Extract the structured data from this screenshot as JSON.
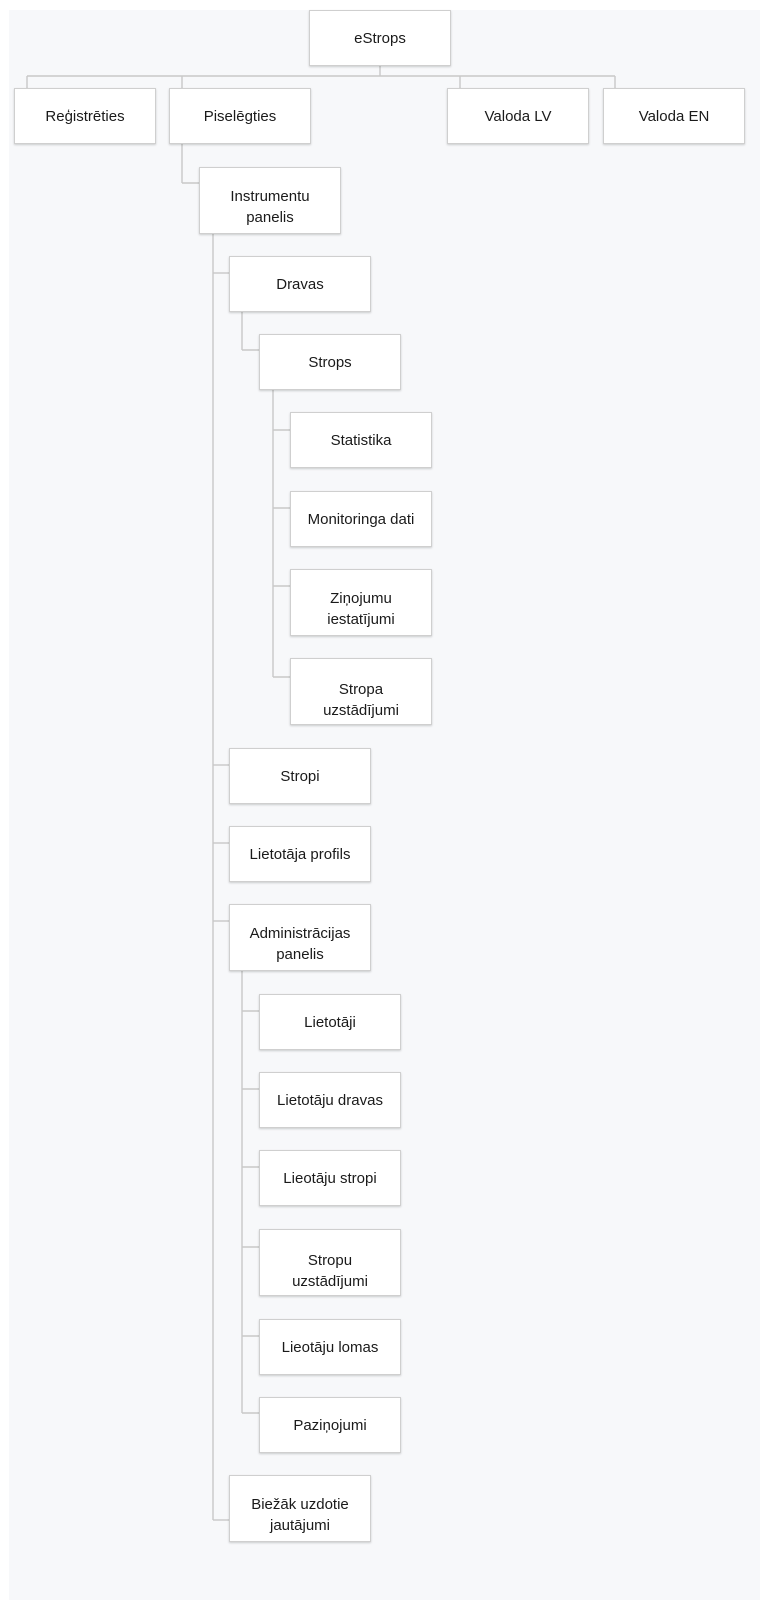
{
  "sitemap": {
    "root": {
      "label": "eStrops"
    },
    "top_level": {
      "register": "Reģistrēties",
      "login": "Piselēgties",
      "lang_lv": "Valoda LV",
      "lang_en": "Valoda EN"
    },
    "dashboard": {
      "label_line1": "Instrumentu",
      "label_line2": "panelis"
    },
    "dravas": {
      "label": "Dravas",
      "strops": {
        "label": "Strops",
        "statistics": "Statistika",
        "monitoring": "Monitoringa dati",
        "notifications_line1": "Ziņojumu",
        "notifications_line2": "iestatījumi",
        "hive_settings_line1": "Stropa",
        "hive_settings_line2": "uzstādījumi"
      }
    },
    "stropi": "Stropi",
    "user_profile": "Lietotāja profils",
    "admin": {
      "label_line1": "Administrācijas",
      "label_line2": "panelis",
      "users": "Lietotāji",
      "user_apiaries": "Lietotāju dravas",
      "user_hives": "Lieotāju stropi",
      "hive_settings_line1": "Stropu",
      "hive_settings_line2": "uzstādījumi",
      "user_roles": "Lieotāju lomas",
      "announcements": "Paziņojumi"
    },
    "faq": {
      "label_line1": "Biežāk uzdotie",
      "label_line2": "jautājumi"
    }
  }
}
